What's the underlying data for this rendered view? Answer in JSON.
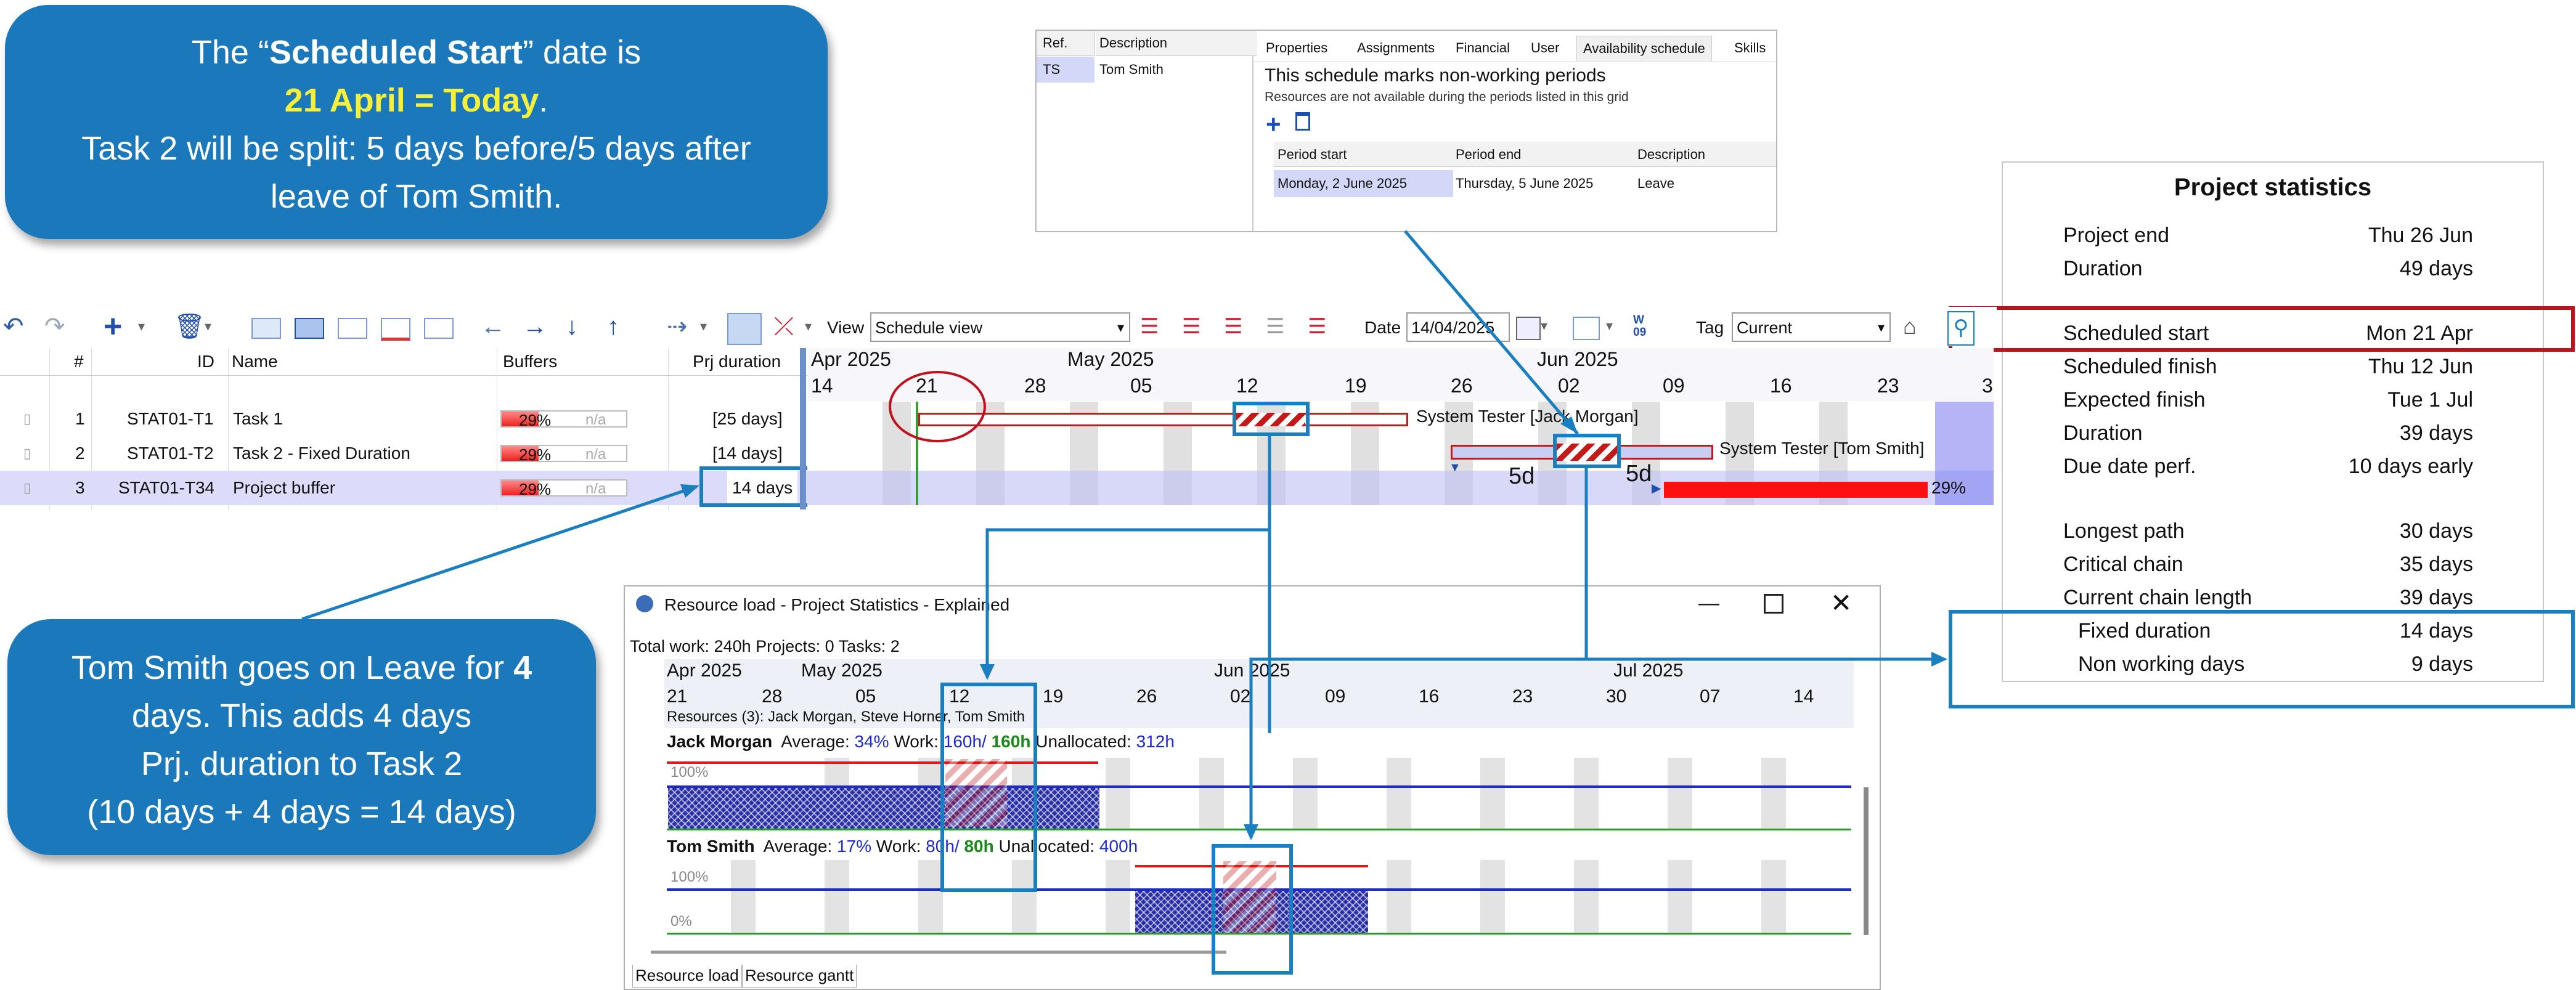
{
  "callout_top": {
    "line1_pre": "The “",
    "line1_bold": "Scheduled Start",
    "line1_post": "” date is",
    "line2_yellow": "21 April = Today",
    "line2_post": ".",
    "line3": "Task 2 will be split: 5 days before/5 days after",
    "line4": "leave of Tom Smith."
  },
  "callout_bottom": {
    "line1_pre": "Tom Smith goes on Leave for ",
    "line1_bold": "4",
    "line2": "days.  This adds 4 days",
    "line3": "Prj. duration to Task 2",
    "line4": "(10 days + 4 days = 14 days)"
  },
  "resource_panel": {
    "col_ref": "Ref.",
    "col_desc": "Description",
    "ref": "TS",
    "name": "Tom Smith",
    "tabs": [
      "Properties",
      "Assignments",
      "Financial",
      "User",
      "Availability schedule",
      "Skills"
    ],
    "heading": "This schedule marks non-working periods",
    "sub": "Resources are not available during the periods listed in this grid",
    "cols": [
      "Period start",
      "Period end",
      "Description"
    ],
    "period_start": "Monday, 2 June 2025",
    "period_end": "Thursday, 5 June 2025",
    "period_desc": "Leave"
  },
  "toolbar": {
    "view_label": "View",
    "view_value": "Schedule view",
    "date_label": "Date",
    "date_value": "14/04/2025",
    "tag_label": "Tag",
    "tag_value": "Current",
    "w_icon_text": "W\n09"
  },
  "grid": {
    "headers": {
      "num": "#",
      "id": "ID",
      "name": "Name",
      "buffers": "Buffers",
      "duration": "Prj duration"
    },
    "rows": [
      {
        "num": "1",
        "id": "STAT01-T1",
        "name": "Task 1",
        "buf": "29%",
        "na": "n/a",
        "dur": "[25 days]"
      },
      {
        "num": "2",
        "id": "STAT01-T2",
        "name": "Task 2 - Fixed Duration",
        "buf": "29%",
        "na": "n/a",
        "dur": "[14 days]"
      },
      {
        "num": "3",
        "id": "STAT01-T34",
        "name": "Project buffer",
        "buf": "29%",
        "na": "n/a",
        "dur": "14 days"
      }
    ]
  },
  "gantt": {
    "months": [
      "Apr 2025",
      "May 2025",
      "Jun 2025"
    ],
    "days": [
      "14",
      "21",
      "28",
      "05",
      "12",
      "19",
      "26",
      "02",
      "09",
      "16",
      "23",
      "3"
    ],
    "task1_label": "System Tester [Jack Morgan]",
    "task2_label": "System Tester [Tom Smith]",
    "split_before": "5d",
    "split_after": "5d",
    "buffer_pct": "29%"
  },
  "stats": {
    "title": "Project statistics",
    "rows": [
      {
        "label": "Project end",
        "value": "Thu 26 Jun"
      },
      {
        "label": "Duration",
        "value": "49 days"
      },
      {
        "label": "Scheduled start",
        "value": "Mon 21 Apr"
      },
      {
        "label": "Scheduled finish",
        "value": "Thu 12 Jun"
      },
      {
        "label": "Expected finish",
        "value": "Tue 1 Jul"
      },
      {
        "label": "Duration",
        "value": "39 days"
      },
      {
        "label": "Due date perf.",
        "value": "10 days early"
      },
      {
        "label": "Longest path",
        "value": "30 days"
      },
      {
        "label": "Critical chain",
        "value": "35 days"
      },
      {
        "label": "Current chain length",
        "value": "39 days"
      },
      {
        "label": "Fixed duration",
        "value": "14 days"
      },
      {
        "label": "Non working days",
        "value": "9 days"
      }
    ]
  },
  "resource_load": {
    "title": "Resource load - Project Statistics - Explained",
    "summary": "Total work: 240h  Projects: 0  Tasks: 2",
    "months": [
      "Apr 2025",
      "May 2025",
      "Jun 2025",
      "Jul 2025"
    ],
    "days": [
      "21",
      "28",
      "05",
      "12",
      "19",
      "26",
      "02",
      "09",
      "16",
      "23",
      "30",
      "07",
      "14"
    ],
    "resources_line": "Resources (3): Jack Morgan, Steve Horner, Tom Smith",
    "r1_name": "Jack Morgan",
    "r1_avg_label": "Average:",
    "r1_avg": "34%",
    "r1_work_label": "Work:",
    "r1_work": "160h/",
    "r1_work2": "160h",
    "r1_unalloc_label": "Unallocated:",
    "r1_unalloc": "312h",
    "r2_name": "Tom Smith",
    "r2_avg_label": "Average:",
    "r2_avg": "17%",
    "r2_work_label": "Work:",
    "r2_work": "80h/",
    "r2_work2": "80h",
    "r2_unalloc_label": "Unallocated:",
    "r2_unalloc": "400h",
    "pct100": "100%",
    "pct0": "0%",
    "tab1": "Resource load",
    "tab2": "Resource gantt"
  }
}
